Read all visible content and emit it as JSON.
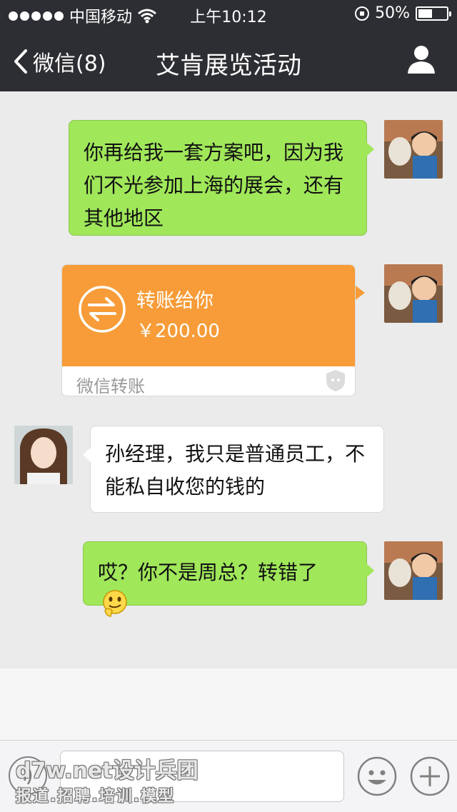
{
  "status_bar": {
    "carrier": "中国移动",
    "time": "上午10:12",
    "battery_percent": "50%",
    "battery_level": 0.5,
    "signal_icon": "signal-dots-icon",
    "wifi_icon": "wifi-icon",
    "lock_icon": "rotation-lock-icon"
  },
  "nav": {
    "back_label": "微信(8)",
    "title": "艾肯展览活动",
    "back_icon": "chevron-left-icon",
    "profile_icon": "person-icon"
  },
  "messages": [
    {
      "side": "right",
      "type": "text",
      "text": "你再给我一套方案吧，因为我们不光参加上海的展会，还有其他地区"
    },
    {
      "side": "right",
      "type": "transfer",
      "title": "转账给你",
      "amount": "￥200.00",
      "footer": "微信转账",
      "icon": "transfer-arrows-icon"
    },
    {
      "side": "left",
      "type": "text",
      "text": "孙经理，我只是普通员工，不能私自收您的钱的"
    },
    {
      "side": "right",
      "type": "text",
      "text": "哎？你不是周总？转错了",
      "emoji": "thinking-face-icon"
    }
  ],
  "input_bar": {
    "voice_icon": "voice-icon",
    "input_placeholder": "",
    "emoji_icon": "smiley-icon",
    "plus_icon": "plus-icon"
  },
  "watermark": {
    "line1": "d7w.net设计兵团",
    "line2": "报道.招聘.培训.模型"
  },
  "colors": {
    "navbar": "#2d2e33",
    "chat_bg": "#ebebeb",
    "green_bubble": "#a0e75a",
    "transfer_orange": "#f79c38"
  }
}
